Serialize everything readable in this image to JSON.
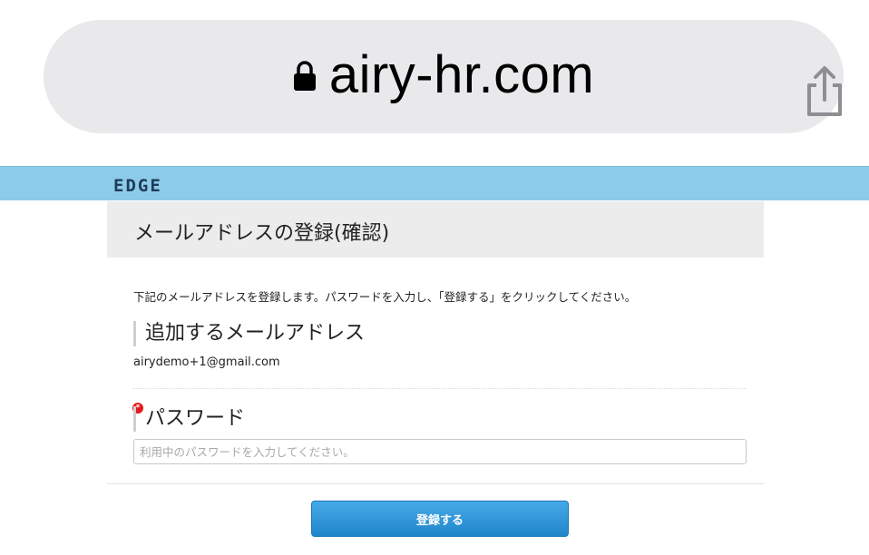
{
  "browser": {
    "url": "airy-hr.com",
    "lock_icon": "lock-icon",
    "share_icon": "share-icon"
  },
  "header": {
    "logo_text": "EDGE",
    "bar_color": "#8ccbe9"
  },
  "page": {
    "title": "メールアドレスの登録(確認)",
    "instruction": "下記のメールアドレスを登録します。パスワードを入力し、「登録する」をクリックしてください。",
    "email_section": {
      "label": "追加するメールアドレス",
      "value": "airydemo+1@gmail.com"
    },
    "password_section": {
      "label": "パスワード",
      "required_mark": "*",
      "placeholder": "利用中のパスワードを入力してください。",
      "value": ""
    },
    "submit_label": "登録する",
    "accent_color": "#1f86cc"
  }
}
